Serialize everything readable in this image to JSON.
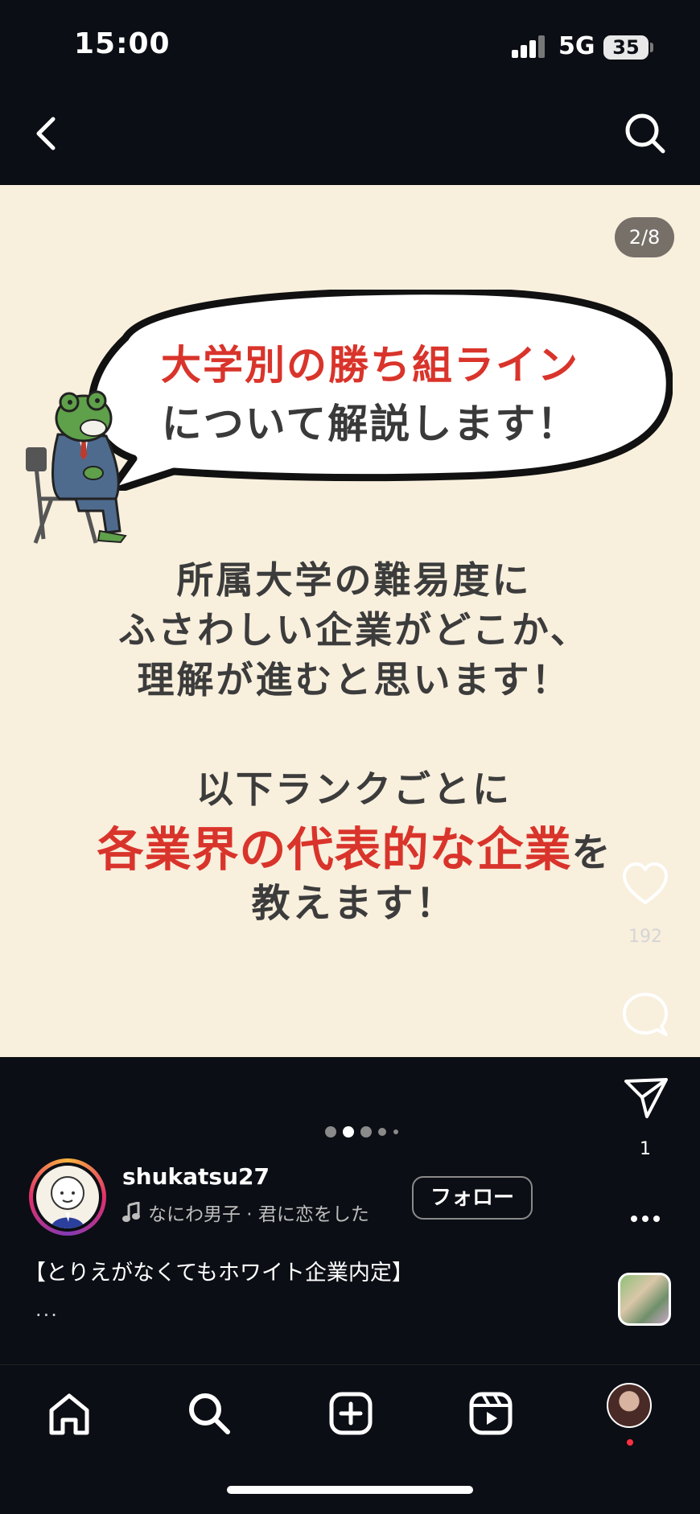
{
  "status": {
    "time": "15:00",
    "network": "5G",
    "battery": "35"
  },
  "post": {
    "counter": "2/8",
    "bubble_red": "大学別の勝ち組ライン",
    "bubble_dark": "について解説します！",
    "body_line1": "所属大学の難易度に",
    "body_line2": "ふさわしい企業がどこか、",
    "body_line3": "理解が進むと思います！",
    "rank_line": "以下ランクごとに",
    "red_emphasis": "各業界の代表的な企業",
    "red_suffix": "を",
    "last_line": "教えます！"
  },
  "actions": {
    "likes": "192",
    "shares": "1"
  },
  "author": {
    "username": "shukatsu27",
    "music": "なにわ男子 · 君に恋をした",
    "follow_label": "フォロー"
  },
  "caption": "【とりえがなくてもホワイト企業内定】",
  "caption_more": "...",
  "carousel": {
    "total_dots": 5,
    "active_index": 1
  },
  "colors": {
    "accent_red": "#d9342b",
    "background": "#0b0e14",
    "post_bg": "#f8efdd",
    "notification": "#ff3040"
  },
  "icons": [
    "back-chevron-icon",
    "search-icon",
    "heart-icon",
    "comment-icon",
    "send-icon",
    "more-icon",
    "music-note-icon",
    "home-icon",
    "create-icon",
    "reels-icon"
  ]
}
